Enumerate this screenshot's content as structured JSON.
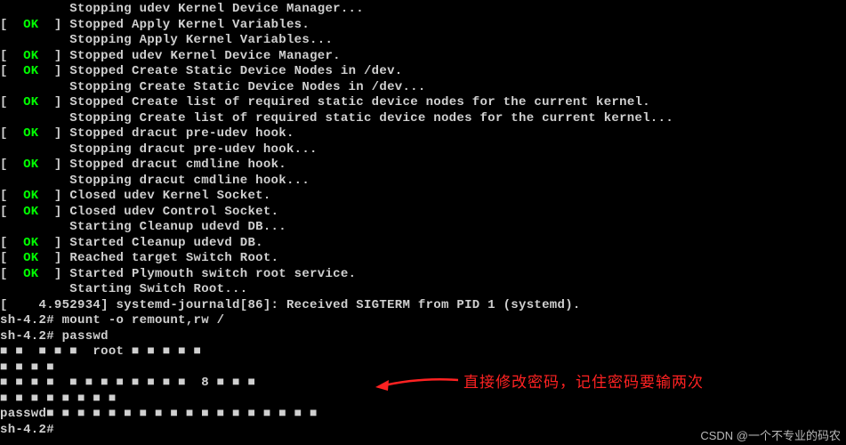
{
  "lines": [
    {
      "type": "indent",
      "text": "Stopping udev Kernel Device Manager..."
    },
    {
      "type": "ok",
      "text": "Stopped Apply Kernel Variables."
    },
    {
      "type": "indent",
      "text": "Stopping Apply Kernel Variables..."
    },
    {
      "type": "ok",
      "text": "Stopped udev Kernel Device Manager."
    },
    {
      "type": "ok",
      "text": "Stopped Create Static Device Nodes in /dev."
    },
    {
      "type": "indent",
      "text": "Stopping Create Static Device Nodes in /dev..."
    },
    {
      "type": "ok",
      "text": "Stopped Create list of required static device nodes for the current kernel."
    },
    {
      "type": "indent",
      "text": "Stopping Create list of required static device nodes for the current kernel..."
    },
    {
      "type": "ok",
      "text": "Stopped dracut pre-udev hook."
    },
    {
      "type": "indent",
      "text": "Stopping dracut pre-udev hook..."
    },
    {
      "type": "ok",
      "text": "Stopped dracut cmdline hook."
    },
    {
      "type": "indent",
      "text": "Stopping dracut cmdline hook..."
    },
    {
      "type": "ok",
      "text": "Closed udev Kernel Socket."
    },
    {
      "type": "ok",
      "text": "Closed udev Control Socket."
    },
    {
      "type": "indent",
      "text": "Starting Cleanup udevd DB..."
    },
    {
      "type": "ok",
      "text": "Started Cleanup udevd DB."
    },
    {
      "type": "ok",
      "text": "Reached target Switch Root."
    },
    {
      "type": "ok",
      "text": "Started Plymouth switch root service."
    },
    {
      "type": "indent",
      "text": "Starting Switch Root..."
    },
    {
      "type": "plain",
      "text": "[    4.952934] systemd-journald[86]: Received SIGTERM from PID 1 (systemd)."
    },
    {
      "type": "plain",
      "text": "sh-4.2# mount -o remount,rw /"
    },
    {
      "type": "plain",
      "text": "sh-4.2# passwd"
    },
    {
      "type": "plain",
      "text": "■ ■  ■ ■ ■  root ■ ■ ■ ■ ■"
    },
    {
      "type": "plain",
      "text": "■ ■ ■ ■"
    },
    {
      "type": "plain",
      "text": "■ ■ ■ ■  ■ ■ ■ ■ ■ ■ ■ ■  8 ■ ■ ■"
    },
    {
      "type": "plain",
      "text": "■ ■ ■ ■ ■ ■ ■ ■"
    },
    {
      "type": "plain",
      "text": "passwd■ ■ ■ ■ ■ ■ ■ ■ ■ ■ ■ ■ ■ ■ ■ ■ ■ ■"
    },
    {
      "type": "plain",
      "text": "sh-4.2#"
    }
  ],
  "ok_label": "OK",
  "annotation": "直接修改密码，记住密码要输两次",
  "watermark": "CSDN @一个不专业的码农"
}
